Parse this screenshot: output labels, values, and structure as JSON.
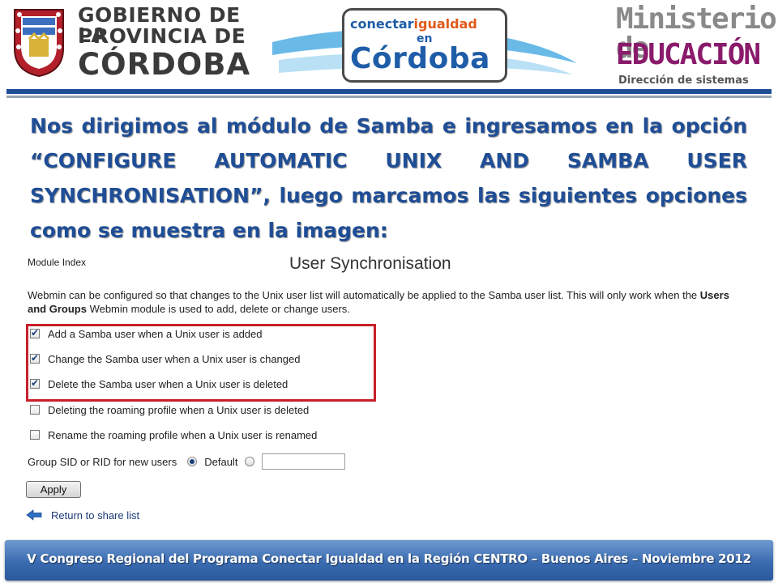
{
  "header": {
    "gov_logo": {
      "line1": "GOBIERNO DE LA",
      "line2": "PROVINCIA DE",
      "line3": "CÓRDOBA"
    },
    "program_logo": {
      "top_part_a": "conectar",
      "top_part_b": "igualdad",
      "middle": "en",
      "main": "Córdoba"
    },
    "ministry_logo": {
      "line1": "Ministerio de",
      "line2": "EDUCACIÓN",
      "line3": "Dirección de sistemas"
    }
  },
  "slide": {
    "heading": "Nos dirigimos al módulo de Samba e ingresamos en la opción “CONFIGURE AUTOMATIC UNIX AND SAMBA USER SYNCHRONISATION”, luego marcamos las siguientes opciones como se muestra en la imagen:"
  },
  "webmin": {
    "module_index": "Module Index",
    "title": "User Synchronisation",
    "description_pre": "Webmin can be configured so that changes to the Unix user list will automatically be applied to the Samba user list. This will only work when the ",
    "description_bold": "Users and Groups",
    "description_post": " Webmin module is used to add, delete or change users.",
    "options": [
      {
        "label": "Add a Samba user when a Unix user is added",
        "checked": true
      },
      {
        "label": "Change the Samba user when a Unix user is changed",
        "checked": true
      },
      {
        "label": "Delete the Samba user when a Unix user is deleted",
        "checked": true
      },
      {
        "label": "Deleting the roaming profile when a Unix user is deleted",
        "checked": false
      },
      {
        "label": "Rename the roaming profile when a Unix user is renamed",
        "checked": false
      }
    ],
    "sid_label": "Group SID or RID for new users",
    "sid_default_label": "Default",
    "sid_value": "",
    "apply_label": "Apply",
    "return_label": "Return to share list"
  },
  "footer": {
    "text": "V Congreso Regional del Programa Conectar Igualdad en la Región CENTRO – Buenos Aires – Noviembre 2012"
  },
  "colors": {
    "heading_blue": "#1f4e96",
    "highlight_red": "#c8202a",
    "footer_blue": "#3a6bb0",
    "ministry_purple": "#8a1a6b"
  }
}
